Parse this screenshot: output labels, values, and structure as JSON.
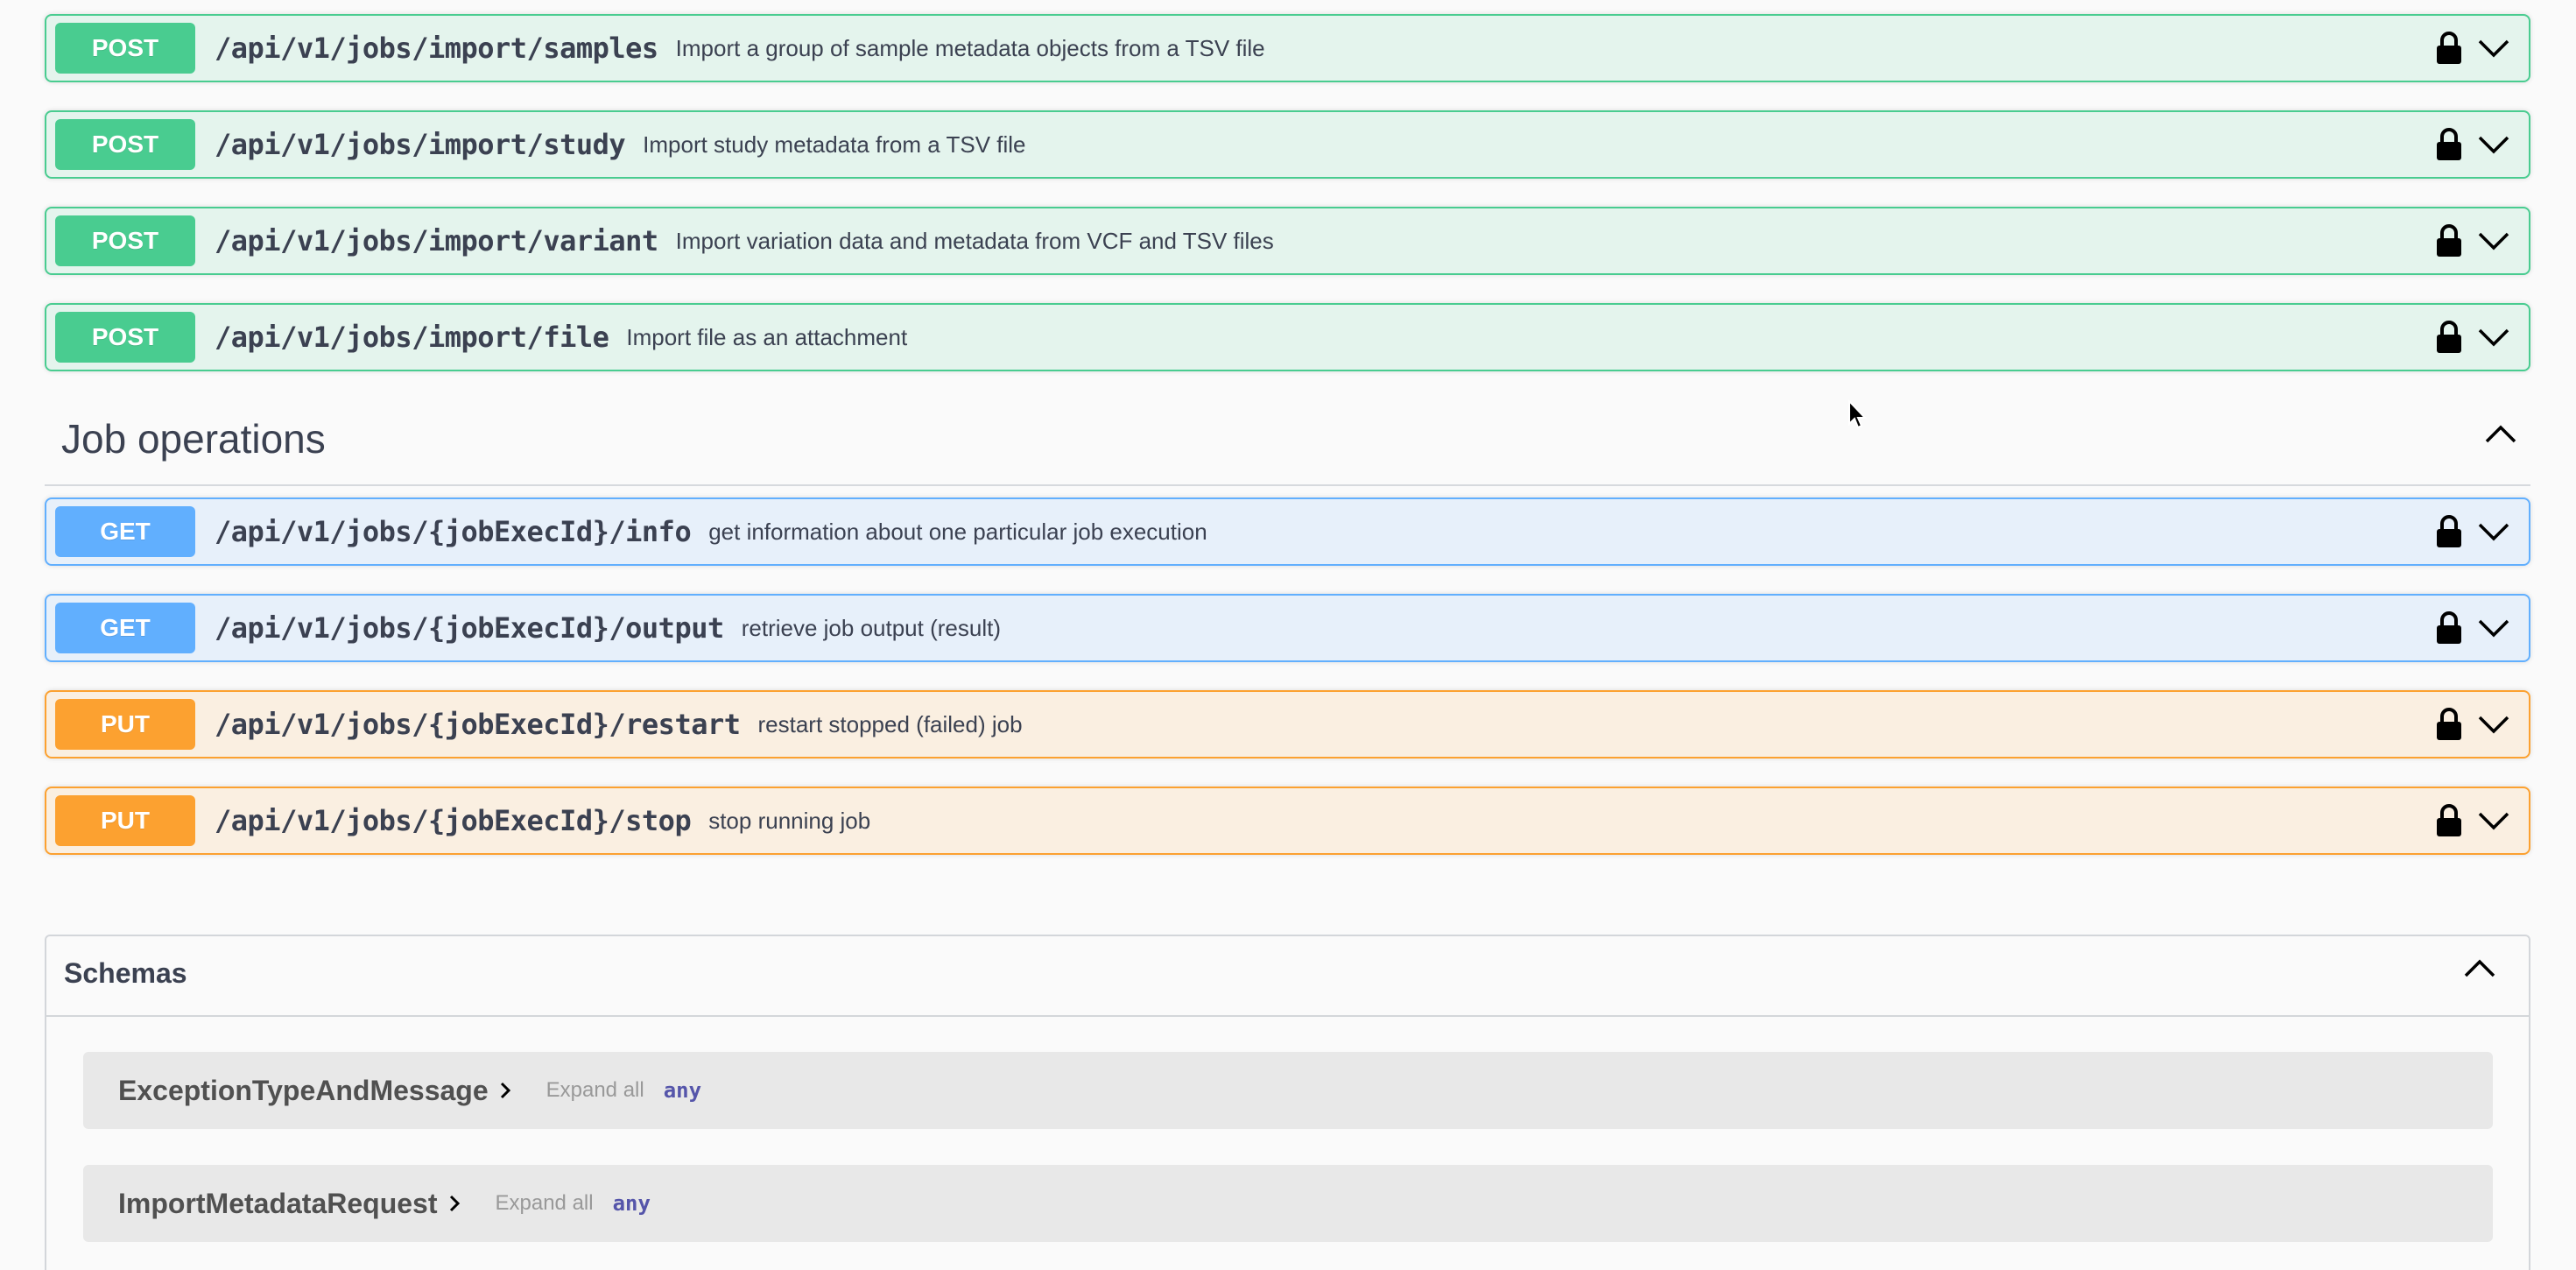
{
  "operations_top": [
    {
      "method": "POST",
      "path": "/api/v1/jobs/import/samples",
      "summary": "Import a group of sample metadata objects from a TSV file"
    },
    {
      "method": "POST",
      "path": "/api/v1/jobs/import/study",
      "summary": "Import study metadata from a TSV file"
    },
    {
      "method": "POST",
      "path": "/api/v1/jobs/import/variant",
      "summary": "Import variation data and metadata from VCF and TSV files"
    },
    {
      "method": "POST",
      "path": "/api/v1/jobs/import/file",
      "summary": "Import file as an attachment"
    }
  ],
  "job_operations": {
    "title": "Job operations",
    "operations": [
      {
        "method": "GET",
        "path": "/api/v1/jobs/{jobExecId}/info",
        "summary": "get information about one particular job execution"
      },
      {
        "method": "GET",
        "path": "/api/v1/jobs/{jobExecId}/output",
        "summary": "retrieve job output (result)"
      },
      {
        "method": "PUT",
        "path": "/api/v1/jobs/{jobExecId}/restart",
        "summary": "restart stopped (failed) job"
      },
      {
        "method": "PUT",
        "path": "/api/v1/jobs/{jobExecId}/stop",
        "summary": "stop running job"
      }
    ]
  },
  "schemas": {
    "title": "Schemas",
    "models": [
      {
        "name": "ExceptionTypeAndMessage",
        "expand_label": "Expand all",
        "type": "any"
      },
      {
        "name": "ImportMetadataRequest",
        "expand_label": "Expand all",
        "type": "any"
      }
    ]
  },
  "icons": {
    "lock": "lock-icon",
    "expand": "chevron-down-icon",
    "collapse": "chevron-up-icon",
    "model_expand": "chevron-right-icon"
  },
  "colors": {
    "post": "#49cc90",
    "get": "#61affe",
    "put": "#fca130"
  }
}
